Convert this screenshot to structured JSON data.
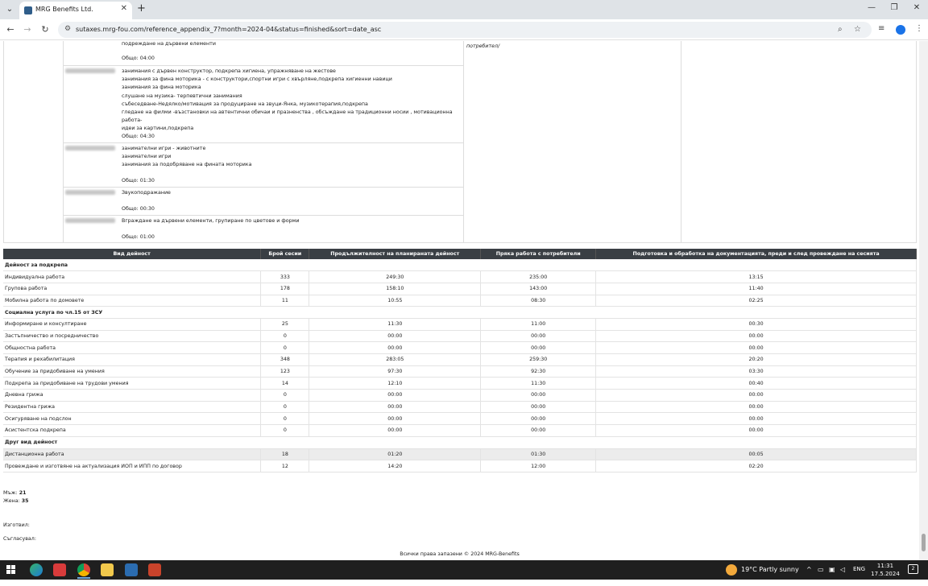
{
  "browser": {
    "tab_title": "MRG Benefits Ltd.",
    "tab_close": "✕",
    "new_tab": "+",
    "url": "sutaxes.mrg-fou.com/reference_appendix_7?month=2024-04&status=finished&sort=date_asc",
    "minimize": "—",
    "restore": "❐",
    "close": "✕"
  },
  "top_table": {
    "first_entry": {
      "lines": [
        "подреждане на дървени елементи"
      ],
      "total": "Общо: 04:00"
    },
    "potrebitel_text": "потребител/",
    "entries": [
      {
        "lines": [
          "занимания с дървен конструктор, подкрепа хигиена, упражняване на жестове",
          "занимания за фина моторика - с конструктори,спортни игри с хвърляне,подкрепа хигиенни навици",
          "занимания за фина моторика",
          "слушане на музика- терпевтични занимания",
          "събеседване-Недялко/мотивация за продуциране на звуци-Янка, музикотерапия,подкрепа",
          "гледане на филми -възстановки на автентични обичаи и празненства , обсъждане на традиционни носии , мотивационна работа-",
          "идеи за картини,подкрепа"
        ],
        "total": "Общо: 04:30"
      },
      {
        "lines": [
          "занимателни игри - животните",
          "занимателни игри",
          "занимания за подобряване на фината моторика"
        ],
        "total": "Общо: 01:30"
      },
      {
        "lines": [
          "Звукоподражание"
        ],
        "total": "Общо: 00:30"
      },
      {
        "lines": [
          "Вграждане на дървени елементи, групиране по цветове и форми"
        ],
        "total": "Общо: 01:00"
      }
    ]
  },
  "main_table": {
    "headers": [
      "Вид дейност",
      "Брой сесии",
      "Продължителност на планираната дейност",
      "Пряка работа с потребители",
      "Подготовка и обработка на документацията, преди и след провеждане на сесията"
    ],
    "rows": [
      {
        "type": "section",
        "label": "Дейност за подкрепа"
      },
      {
        "label": "Индивидуална работа",
        "sessions": "333",
        "planned": "249:30",
        "direct": "235:00",
        "prep": "13:15"
      },
      {
        "label": "Групова работа",
        "sessions": "178",
        "planned": "158:10",
        "direct": "143:00",
        "prep": "11:40"
      },
      {
        "label": "Мобилна работа по домовете",
        "sessions": "11",
        "planned": "10:55",
        "direct": "08:30",
        "prep": "02:25"
      },
      {
        "type": "section",
        "label": "Социална услуга по чл.15 от ЗСУ"
      },
      {
        "label": "Информиране и консултиране",
        "sessions": "25",
        "planned": "11:30",
        "direct": "11:00",
        "prep": "00:30"
      },
      {
        "label": "Застъпничество и посредничество",
        "sessions": "0",
        "planned": "00:00",
        "direct": "00:00",
        "prep": "00:00"
      },
      {
        "label": "Общностна работа",
        "sessions": "0",
        "planned": "00:00",
        "direct": "00:00",
        "prep": "00:00"
      },
      {
        "label": "Терапия и рехабилитация",
        "sessions": "348",
        "planned": "283:05",
        "direct": "259:30",
        "prep": "20:20"
      },
      {
        "label": "Обучение за придобиване на умения",
        "sessions": "123",
        "planned": "97:30",
        "direct": "92:30",
        "prep": "03:30"
      },
      {
        "label": "Подкрепа за придобиване на трудови умения",
        "sessions": "14",
        "planned": "12:10",
        "direct": "11:30",
        "prep": "00:40"
      },
      {
        "label": "Дневна грижа",
        "sessions": "0",
        "planned": "00:00",
        "direct": "00:00",
        "prep": "00:00"
      },
      {
        "label": "Резидентна грижа",
        "sessions": "0",
        "planned": "00:00",
        "direct": "00:00",
        "prep": "00:00"
      },
      {
        "label": "Осигуряване на подслон",
        "sessions": "0",
        "planned": "00:00",
        "direct": "00:00",
        "prep": "00:00"
      },
      {
        "label": "Асистентска подкрепа",
        "sessions": "0",
        "planned": "00:00",
        "direct": "00:00",
        "prep": "00:00"
      },
      {
        "type": "section",
        "label": "Друг вид дейност"
      },
      {
        "label": "Дистанционна работа",
        "sessions": "18",
        "planned": "01:20",
        "direct": "01:30",
        "prep": "00:05",
        "highlight": true
      },
      {
        "label": "Провеждане и изготвяне на актуализация ИОП и ИПП по договор",
        "sessions": "12",
        "planned": "14:20",
        "direct": "12:00",
        "prep": "02:20"
      }
    ]
  },
  "summary": {
    "male_label": "Мъж:",
    "male_value": "21",
    "female_label": "Жена:",
    "female_value": "35",
    "prepared_label": "Изготвил:",
    "agreed_label": "Съгласувал:"
  },
  "footer": "Всички права запазени © 2024 MRG-Benefits",
  "taskbar": {
    "weather": "19°C  Partly sunny",
    "lang": "ENG",
    "time": "11:31",
    "date": "17.5.2024 г.",
    "notifications": "2"
  }
}
